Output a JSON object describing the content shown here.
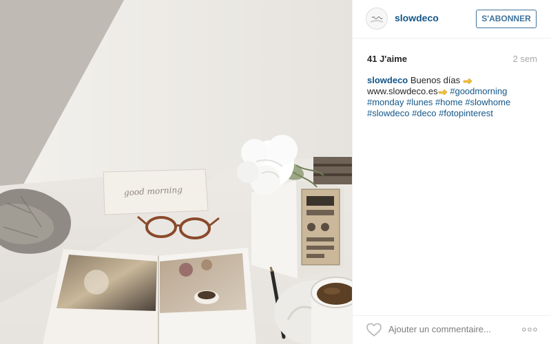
{
  "post": {
    "username": "slowdeco",
    "follow_label": "S'ABONNER",
    "likes": "41 J'aime",
    "time_ago": "2 sem",
    "caption": {
      "author": "slowdeco",
      "text_1": " Buenos días ",
      "link": "www.slowdeco.es",
      "tags_line1": [
        "#goodmorning"
      ],
      "tags_line2": [
        "#monday",
        "#lunes",
        "#home",
        "#slowhome"
      ],
      "tags_line3": [
        "#slowdeco",
        "#deco",
        "#fotopinterest"
      ]
    },
    "comment_placeholder": "Ajouter un commentaire..."
  },
  "photo": {
    "card_text": "good morning",
    "scene": [
      "crumpled-paper",
      "greeting-card",
      "round-glasses",
      "white-flower",
      "white-box",
      "open-book",
      "pencil",
      "coffee-cup"
    ]
  },
  "colors": {
    "link": "#125688",
    "button": "#3f729b",
    "muted": "#a5a7aa",
    "border": "#efefef"
  },
  "icons": [
    "pointing-hand-emoji",
    "heart-icon",
    "more-options-icon"
  ]
}
